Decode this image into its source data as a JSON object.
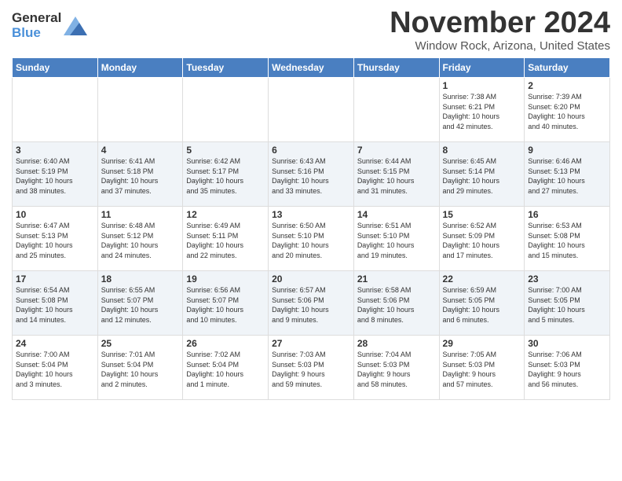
{
  "header": {
    "logo_line1": "General",
    "logo_line2": "Blue",
    "month": "November 2024",
    "location": "Window Rock, Arizona, United States"
  },
  "weekdays": [
    "Sunday",
    "Monday",
    "Tuesday",
    "Wednesday",
    "Thursday",
    "Friday",
    "Saturday"
  ],
  "weeks": [
    [
      {
        "day": "",
        "info": ""
      },
      {
        "day": "",
        "info": ""
      },
      {
        "day": "",
        "info": ""
      },
      {
        "day": "",
        "info": ""
      },
      {
        "day": "",
        "info": ""
      },
      {
        "day": "1",
        "info": "Sunrise: 7:38 AM\nSunset: 6:21 PM\nDaylight: 10 hours\nand 42 minutes."
      },
      {
        "day": "2",
        "info": "Sunrise: 7:39 AM\nSunset: 6:20 PM\nDaylight: 10 hours\nand 40 minutes."
      }
    ],
    [
      {
        "day": "3",
        "info": "Sunrise: 6:40 AM\nSunset: 5:19 PM\nDaylight: 10 hours\nand 38 minutes."
      },
      {
        "day": "4",
        "info": "Sunrise: 6:41 AM\nSunset: 5:18 PM\nDaylight: 10 hours\nand 37 minutes."
      },
      {
        "day": "5",
        "info": "Sunrise: 6:42 AM\nSunset: 5:17 PM\nDaylight: 10 hours\nand 35 minutes."
      },
      {
        "day": "6",
        "info": "Sunrise: 6:43 AM\nSunset: 5:16 PM\nDaylight: 10 hours\nand 33 minutes."
      },
      {
        "day": "7",
        "info": "Sunrise: 6:44 AM\nSunset: 5:15 PM\nDaylight: 10 hours\nand 31 minutes."
      },
      {
        "day": "8",
        "info": "Sunrise: 6:45 AM\nSunset: 5:14 PM\nDaylight: 10 hours\nand 29 minutes."
      },
      {
        "day": "9",
        "info": "Sunrise: 6:46 AM\nSunset: 5:13 PM\nDaylight: 10 hours\nand 27 minutes."
      }
    ],
    [
      {
        "day": "10",
        "info": "Sunrise: 6:47 AM\nSunset: 5:13 PM\nDaylight: 10 hours\nand 25 minutes."
      },
      {
        "day": "11",
        "info": "Sunrise: 6:48 AM\nSunset: 5:12 PM\nDaylight: 10 hours\nand 24 minutes."
      },
      {
        "day": "12",
        "info": "Sunrise: 6:49 AM\nSunset: 5:11 PM\nDaylight: 10 hours\nand 22 minutes."
      },
      {
        "day": "13",
        "info": "Sunrise: 6:50 AM\nSunset: 5:10 PM\nDaylight: 10 hours\nand 20 minutes."
      },
      {
        "day": "14",
        "info": "Sunrise: 6:51 AM\nSunset: 5:10 PM\nDaylight: 10 hours\nand 19 minutes."
      },
      {
        "day": "15",
        "info": "Sunrise: 6:52 AM\nSunset: 5:09 PM\nDaylight: 10 hours\nand 17 minutes."
      },
      {
        "day": "16",
        "info": "Sunrise: 6:53 AM\nSunset: 5:08 PM\nDaylight: 10 hours\nand 15 minutes."
      }
    ],
    [
      {
        "day": "17",
        "info": "Sunrise: 6:54 AM\nSunset: 5:08 PM\nDaylight: 10 hours\nand 14 minutes."
      },
      {
        "day": "18",
        "info": "Sunrise: 6:55 AM\nSunset: 5:07 PM\nDaylight: 10 hours\nand 12 minutes."
      },
      {
        "day": "19",
        "info": "Sunrise: 6:56 AM\nSunset: 5:07 PM\nDaylight: 10 hours\nand 10 minutes."
      },
      {
        "day": "20",
        "info": "Sunrise: 6:57 AM\nSunset: 5:06 PM\nDaylight: 10 hours\nand 9 minutes."
      },
      {
        "day": "21",
        "info": "Sunrise: 6:58 AM\nSunset: 5:06 PM\nDaylight: 10 hours\nand 8 minutes."
      },
      {
        "day": "22",
        "info": "Sunrise: 6:59 AM\nSunset: 5:05 PM\nDaylight: 10 hours\nand 6 minutes."
      },
      {
        "day": "23",
        "info": "Sunrise: 7:00 AM\nSunset: 5:05 PM\nDaylight: 10 hours\nand 5 minutes."
      }
    ],
    [
      {
        "day": "24",
        "info": "Sunrise: 7:00 AM\nSunset: 5:04 PM\nDaylight: 10 hours\nand 3 minutes."
      },
      {
        "day": "25",
        "info": "Sunrise: 7:01 AM\nSunset: 5:04 PM\nDaylight: 10 hours\nand 2 minutes."
      },
      {
        "day": "26",
        "info": "Sunrise: 7:02 AM\nSunset: 5:04 PM\nDaylight: 10 hours\nand 1 minute."
      },
      {
        "day": "27",
        "info": "Sunrise: 7:03 AM\nSunset: 5:03 PM\nDaylight: 9 hours\nand 59 minutes."
      },
      {
        "day": "28",
        "info": "Sunrise: 7:04 AM\nSunset: 5:03 PM\nDaylight: 9 hours\nand 58 minutes."
      },
      {
        "day": "29",
        "info": "Sunrise: 7:05 AM\nSunset: 5:03 PM\nDaylight: 9 hours\nand 57 minutes."
      },
      {
        "day": "30",
        "info": "Sunrise: 7:06 AM\nSunset: 5:03 PM\nDaylight: 9 hours\nand 56 minutes."
      }
    ]
  ]
}
